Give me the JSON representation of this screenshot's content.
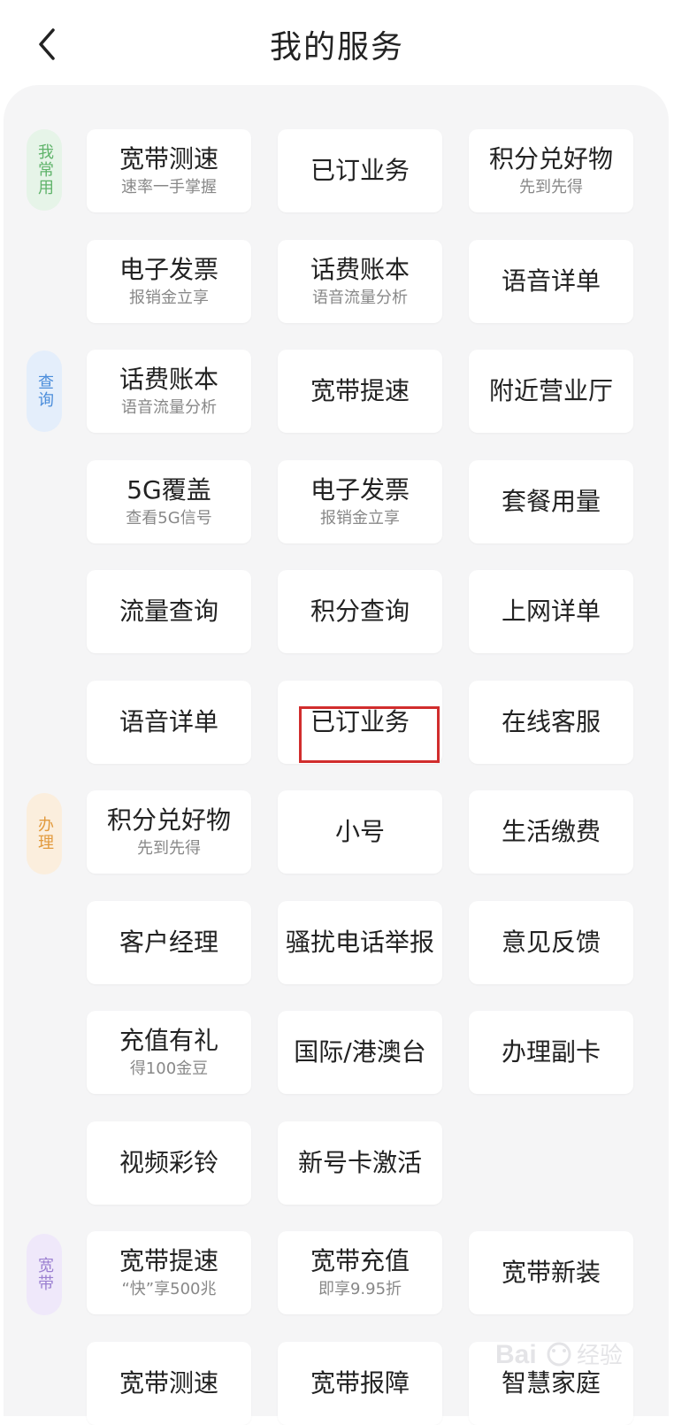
{
  "header": {
    "title": "我的服务"
  },
  "categories": [
    {
      "label": "我常用",
      "color": "#5fb36a",
      "bg": "#e6f4e8"
    },
    {
      "label": "查询",
      "color": "#4b8ddb",
      "bg": "#e4eefb"
    },
    {
      "label": "办理",
      "color": "#e29a3d",
      "bg": "#fbeedd"
    },
    {
      "label": "宽带",
      "color": "#9b7fd1",
      "bg": "#efe8fa"
    }
  ],
  "cards": [
    {
      "name": "宽带测速",
      "sub": "速率一手掌握"
    },
    {
      "name": "已订业务",
      "sub": ""
    },
    {
      "name": "积分兑好物",
      "sub": "先到先得"
    },
    {
      "name": "电子发票",
      "sub": "报销金立享"
    },
    {
      "name": "话费账本",
      "sub": "语音流量分析"
    },
    {
      "name": "语音详单",
      "sub": ""
    },
    {
      "name": "话费账本",
      "sub": "语音流量分析"
    },
    {
      "name": "宽带提速",
      "sub": ""
    },
    {
      "name": "附近营业厅",
      "sub": ""
    },
    {
      "name": "5G覆盖",
      "sub": "查看5G信号"
    },
    {
      "name": "电子发票",
      "sub": "报销金立享"
    },
    {
      "name": "套餐用量",
      "sub": ""
    },
    {
      "name": "流量查询",
      "sub": ""
    },
    {
      "name": "积分查询",
      "sub": ""
    },
    {
      "name": "上网详单",
      "sub": ""
    },
    {
      "name": "语音详单",
      "sub": ""
    },
    {
      "name": "已订业务",
      "sub": ""
    },
    {
      "name": "在线客服",
      "sub": ""
    },
    {
      "name": "积分兑好物",
      "sub": "先到先得"
    },
    {
      "name": "小号",
      "sub": ""
    },
    {
      "name": "生活缴费",
      "sub": ""
    },
    {
      "name": "客户经理",
      "sub": ""
    },
    {
      "name": "骚扰电话举报",
      "sub": ""
    },
    {
      "name": "意见反馈",
      "sub": ""
    },
    {
      "name": "充值有礼",
      "sub": "得100金豆"
    },
    {
      "name": "国际/港澳台",
      "sub": ""
    },
    {
      "name": "办理副卡",
      "sub": ""
    },
    {
      "name": "视频彩铃",
      "sub": ""
    },
    {
      "name": "新号卡激活",
      "sub": ""
    },
    {
      "name": "宽带提速",
      "sub": "“快”享500兆"
    },
    {
      "name": "宽带充值",
      "sub": "即享9.95折"
    },
    {
      "name": "宽带新装",
      "sub": ""
    },
    {
      "name": "宽带测速",
      "sub": ""
    },
    {
      "name": "宽带报障",
      "sub": ""
    },
    {
      "name": "智慧家庭",
      "sub": ""
    }
  ],
  "watermark": {
    "text": "Bai 经验"
  },
  "colors": {
    "highlight": "#d12d2d",
    "panel_bg": "#f5f5f6"
  }
}
